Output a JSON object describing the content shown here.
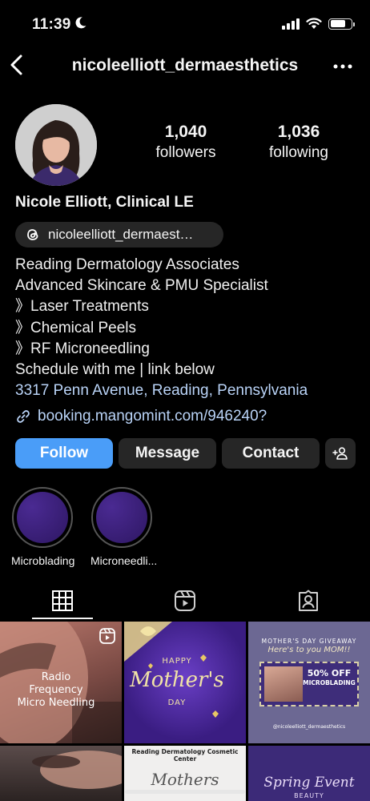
{
  "status_bar": {
    "time": "11:39"
  },
  "header": {
    "username": "nicoleelliott_dermaesthetics"
  },
  "profile": {
    "followers_count": "1,040",
    "followers_label": "followers",
    "following_count": "1,036",
    "following_label": "following",
    "full_name": "Nicole Elliott, Clinical LE",
    "threads_handle": "nicoleelliott_dermaest…",
    "bio_lines": [
      "Reading Dermatology Associates",
      "Advanced Skincare & PMU Specialist",
      "》Laser Treatments",
      "》Chemical Peels",
      "》RF Microneedling",
      "Schedule with me | link below"
    ],
    "location": "3317 Penn Avenue, Reading, Pennsylvania",
    "link": "booking.mangomint.com/946240?"
  },
  "actions": {
    "follow": "Follow",
    "message": "Message",
    "contact": "Contact"
  },
  "highlights": [
    {
      "label": "Microblading"
    },
    {
      "label": "Microneedli..."
    }
  ],
  "grid": {
    "post1_text": "Radio Frequency Micro Needling",
    "post2_line1": "HAPPY",
    "post2_line2": "Mother's",
    "post2_line3": "DAY",
    "post3_title": "MOTHER'S DAY GIVEAWAY",
    "post3_sub": "Here's to you MOM!!",
    "post3_offer1": "50% OFF",
    "post3_offer2": "MICROBLADING",
    "post3_handle": "@nicoleelliott_dermaesthetics",
    "post5_title": "Reading Dermatology Cosmetic Center",
    "post5_script": "Mothers",
    "post6_script": "Spring Event",
    "post6_sub": "BEAUTY"
  },
  "colors": {
    "follow_button": "#4a9df8",
    "link": "#b9d3f7",
    "highlight_fill": "#3b1f7a"
  }
}
